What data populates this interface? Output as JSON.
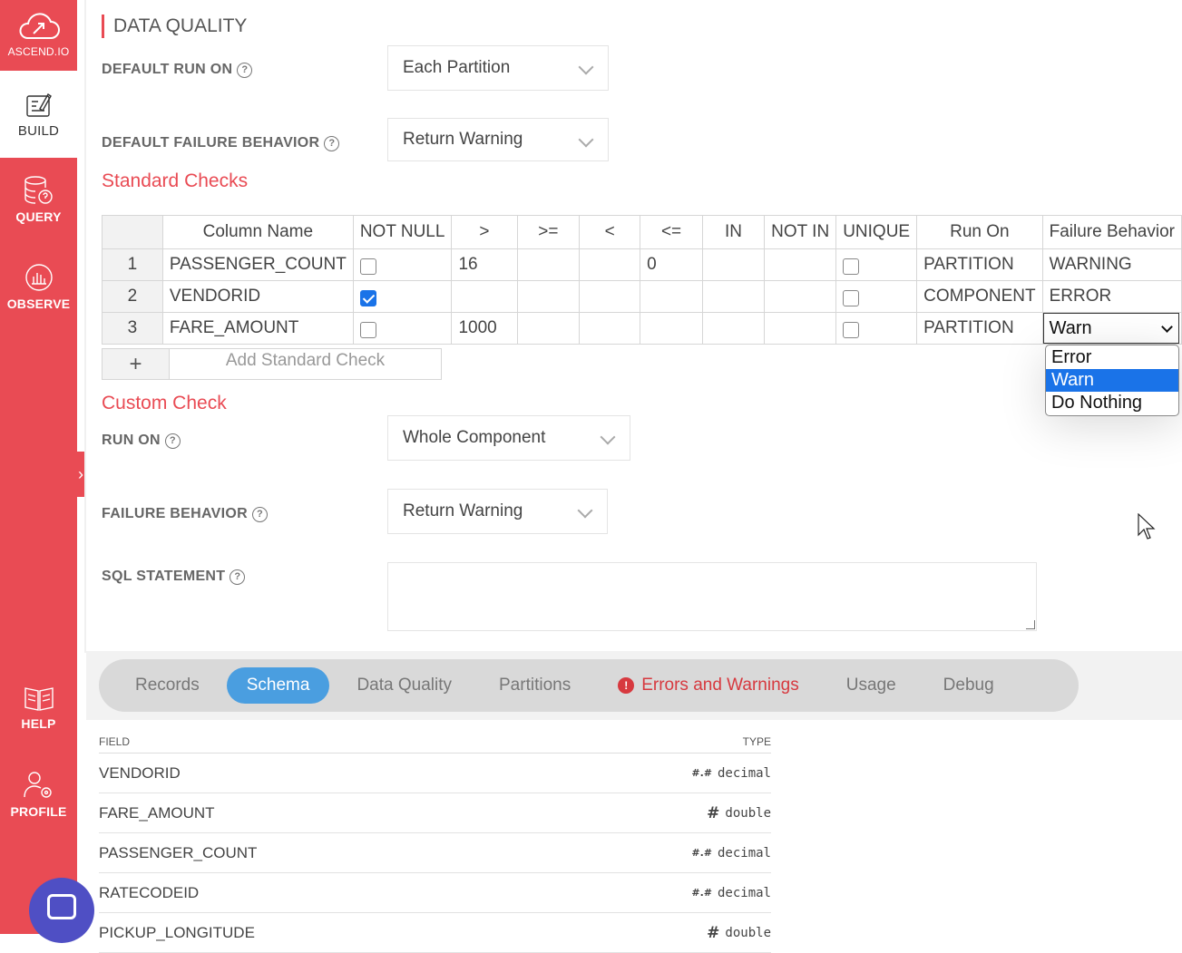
{
  "sidebar": {
    "brand": "ASCEND.IO",
    "items": [
      {
        "label": "BUILD",
        "icon": "build-icon"
      },
      {
        "label": "QUERY",
        "icon": "database-query-icon"
      },
      {
        "label": "OBSERVE",
        "icon": "bar-chart-icon"
      },
      {
        "label": "HELP",
        "icon": "book-icon"
      },
      {
        "label": "PROFILE",
        "icon": "user-gear-icon"
      }
    ],
    "collapse_glyph": "›"
  },
  "data_quality": {
    "title": "DATA QUALITY",
    "default_run_on_label": "DEFAULT RUN ON",
    "default_run_on_value": "Each Partition",
    "default_failure_label": "DEFAULT FAILURE BEHAVIOR",
    "default_failure_value": "Return Warning"
  },
  "standard_checks": {
    "title": "Standard Checks",
    "columns": [
      "Column Name",
      "NOT NULL",
      ">",
      ">=",
      "<",
      "<=",
      "IN",
      "NOT IN",
      "UNIQUE",
      "Run On",
      "Failure Behavior"
    ],
    "rows": [
      {
        "idx": "1",
        "column": "PASSENGER_COUNT",
        "not_null": false,
        "gt": "16",
        "gte": "",
        "lt": "",
        "lte": "0",
        "in": "",
        "not_in": "",
        "unique": false,
        "run_on": "PARTITION",
        "failure": "WARNING"
      },
      {
        "idx": "2",
        "column": "VENDORID",
        "not_null": true,
        "gt": "",
        "gte": "",
        "lt": "",
        "lte": "",
        "in": "",
        "not_in": "",
        "unique": false,
        "run_on": "COMPONENT",
        "failure": "ERROR"
      },
      {
        "idx": "3",
        "column": "FARE_AMOUNT",
        "not_null": false,
        "gt": "1000",
        "gte": "",
        "lt": "",
        "lte": "",
        "in": "",
        "not_in": "",
        "unique": false,
        "run_on": "PARTITION",
        "failure": "Warn"
      }
    ],
    "add_plus": "+",
    "add_label": "Add Standard Check",
    "dropdown_options": [
      "Error",
      "Warn",
      "Do Nothing"
    ],
    "dropdown_selected": "Warn"
  },
  "custom_check": {
    "title": "Custom Check",
    "run_on_label": "RUN ON",
    "run_on_value": "Whole Component",
    "failure_label": "FAILURE BEHAVIOR",
    "failure_value": "Return Warning",
    "sql_label": "SQL STATEMENT",
    "sql_value": ""
  },
  "tabs": {
    "items": [
      "Records",
      "Schema",
      "Data Quality",
      "Partitions",
      "Errors and Warnings",
      "Usage",
      "Debug"
    ],
    "active": "Schema"
  },
  "schema": {
    "field_header": "FIELD",
    "type_header": "TYPE",
    "rows": [
      {
        "field": "VENDORID",
        "glyph": "#.#",
        "type": "decimal"
      },
      {
        "field": "FARE_AMOUNT",
        "glyph": "#",
        "type": "double"
      },
      {
        "field": "PASSENGER_COUNT",
        "glyph": "#.#",
        "type": "decimal"
      },
      {
        "field": "RATECODEID",
        "glyph": "#.#",
        "type": "decimal"
      },
      {
        "field": "PICKUP_LONGITUDE",
        "glyph": "#",
        "type": "double"
      }
    ]
  },
  "colors": {
    "brand_red": "#e94b54",
    "tab_active": "#4a9ee0",
    "error_red": "#d7393f",
    "select_highlight": "#1a73e8"
  }
}
